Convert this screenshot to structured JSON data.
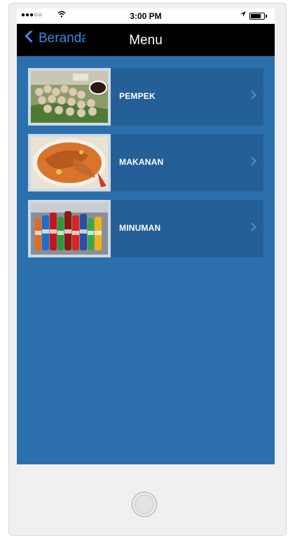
{
  "status_bar": {
    "signal": "●●●○○",
    "wifi_icon": "wifi-icon",
    "time": "3:00 PM",
    "location_icon": "location-arrow-icon",
    "battery_icon": "battery-icon"
  },
  "nav": {
    "back_label": "Beranda",
    "title": "Menu"
  },
  "colors": {
    "screen_background": "#2b70ad",
    "item_background": "#245f98",
    "nav_background": "#000000",
    "back_color": "#3a8ae6",
    "label_color": "#ffffff"
  },
  "menu": {
    "items": [
      {
        "label": "PEMPEK",
        "image": "pempek-food-photo"
      },
      {
        "label": "MAKANAN",
        "image": "fish-curry-photo"
      },
      {
        "label": "MINUMAN",
        "image": "soft-drink-bottles-photo"
      }
    ]
  }
}
